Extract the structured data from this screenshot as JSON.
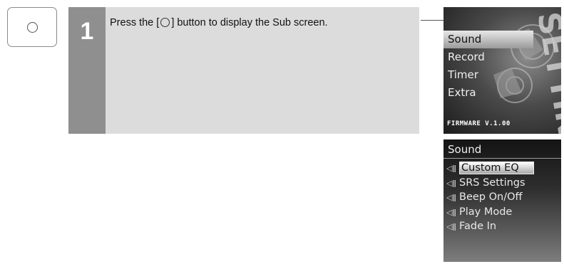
{
  "step": {
    "number": "1",
    "text_before": "Press the [",
    "text_after": "] button to display the Sub screen."
  },
  "screen1": {
    "menu_items": [
      "Sound",
      "Record",
      "Timer",
      "Extra"
    ],
    "selected_index": 0,
    "firmware": "FIRMWARE V.1.00",
    "watermark": "SETTINGS"
  },
  "screen2": {
    "title": "Sound",
    "items": [
      "Custom EQ",
      "SRS Settings",
      "Beep On/Off",
      "Play Mode",
      "Fade In"
    ],
    "selected_index": 0,
    "item_icon": "speaker-icon"
  },
  "colors": {
    "step_bg": "#dcdcdc",
    "step_number_bg": "#8f8f8f"
  }
}
